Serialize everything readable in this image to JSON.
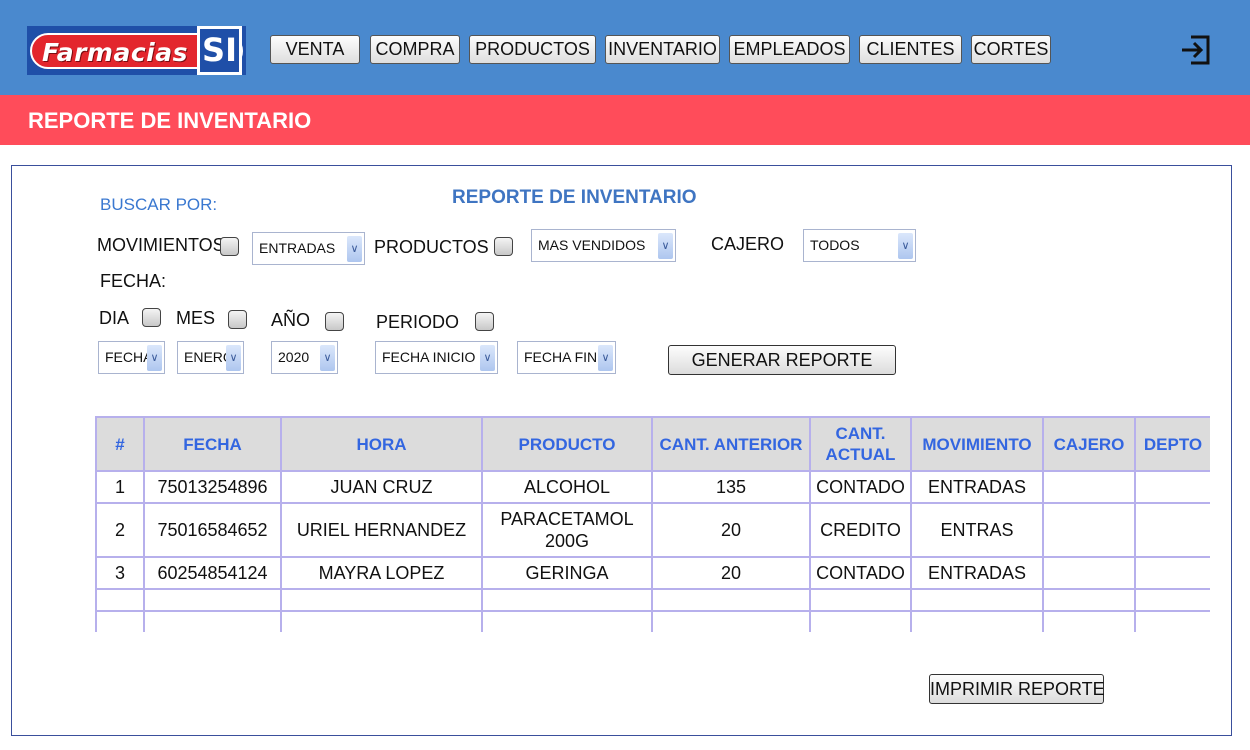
{
  "brand": {
    "logo_text": "Farmacias",
    "logo_badge": "SI"
  },
  "nav": {
    "items": [
      "VENTA",
      "COMPRA",
      "PRODUCTOS",
      "INVENTARIO",
      "EMPLEADOS",
      "CLIENTES",
      "CORTES"
    ]
  },
  "page": {
    "title": "REPORTE DE INVENTARIO"
  },
  "panel": {
    "title": "REPORTE DE INVENTARIO",
    "buscar_label": "BUSCAR POR:",
    "movimientos_label": "MOVIMIENTOS",
    "movimientos_value": "ENTRADAS",
    "productos_label": "PRODUCTOS",
    "productos_value": "MAS VENDIDOS",
    "cajero_label": "CAJERO",
    "cajero_value": "TODOS",
    "fecha_label": "FECHA:",
    "dia_label": "DIA",
    "mes_label": "MES",
    "anio_label": "AÑO",
    "periodo_label": "PERIODO",
    "fecha_value": "FECHA",
    "mes_value": "ENERO",
    "anio_value": "2020",
    "fecha_inicio_value": "FECHA INICIO",
    "fecha_fin_value": "FECHA FIN",
    "generar_label": "GENERAR REPORTE",
    "imprimir_label": "IMPRIMIR REPORTE"
  },
  "table": {
    "headers": [
      "#",
      "FECHA",
      "HORA",
      "PRODUCTO",
      "CANT. ANTERIOR",
      "CANT. ACTUAL",
      "MOVIMIENTO",
      "CAJERO",
      "DEPTO"
    ],
    "rows": [
      [
        "1",
        "75013254896",
        "JUAN CRUZ",
        "ALCOHOL",
        "135",
        "CONTADO",
        "ENTRADAS",
        "",
        ""
      ],
      [
        "2",
        "75016584652",
        "URIEL HERNANDEZ",
        "PARACETAMOL 200G",
        "20",
        "CREDITO",
        "ENTRAS",
        "",
        ""
      ],
      [
        "3",
        "60254854124",
        "MAYRA LOPEZ",
        "GERINGA",
        "20",
        "CONTADO",
        "ENTRADAS",
        "",
        ""
      ]
    ]
  },
  "colors": {
    "header_bg": "#4a89ce",
    "title_bar_bg": "#ff4c5a",
    "accent_text": "#3366e0"
  }
}
